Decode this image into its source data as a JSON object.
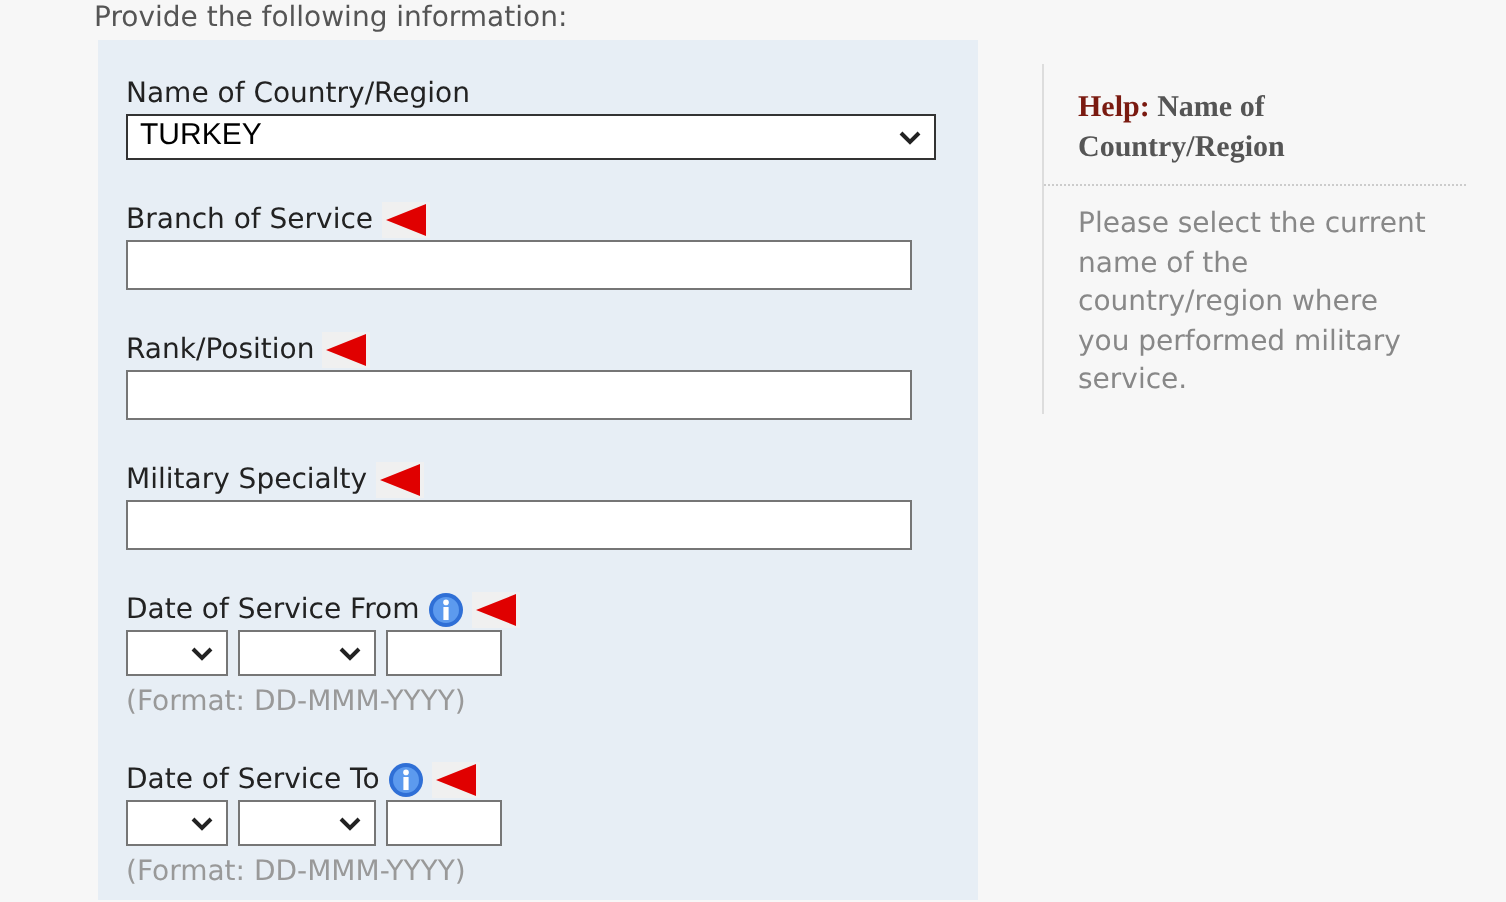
{
  "intro": "Provide the following information:",
  "fields": [
    {
      "kind": "select",
      "label": "Name of Country/Region",
      "value": "TURKEY",
      "required": false,
      "info": false
    },
    {
      "kind": "text",
      "label": "Branch of Service",
      "required": true,
      "info": false
    },
    {
      "kind": "text",
      "label": "Rank/Position",
      "required": true,
      "info": false
    },
    {
      "kind": "text",
      "label": "Military Specialty",
      "required": true,
      "info": false
    },
    {
      "kind": "date",
      "label": "Date of Service From",
      "format": "(Format: DD-MMM-YYYY)",
      "required": true,
      "info": true
    },
    {
      "kind": "date",
      "label": "Date of Service To",
      "format": "(Format: DD-MMM-YYYY)",
      "required": true,
      "info": true
    }
  ],
  "help": {
    "prefix": "Help:",
    "title": "Name of Country/Region",
    "body": "Please select the current name of the country/region where you performed military service."
  }
}
